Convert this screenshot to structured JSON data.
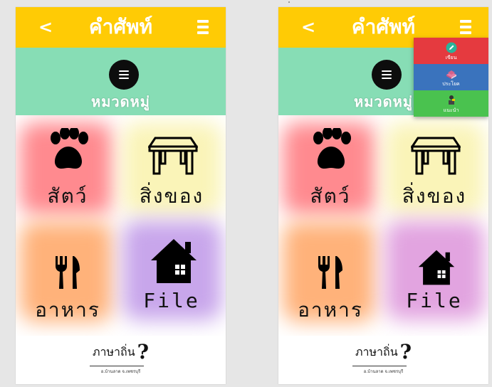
{
  "screens": [
    {
      "header": {
        "back_icon": "chevron-left-icon",
        "back_label": "<",
        "title": "คำศัพท์",
        "menu_icon": "hamburger-menu-icon"
      },
      "category": {
        "icon": "menu-circle-icon",
        "label": "หมวดหมู่"
      },
      "tiles": [
        {
          "icon": "paw-icon",
          "label": "สัตว์",
          "color": "#ff8a8f"
        },
        {
          "icon": "table-icon",
          "label": "สิ่งของ",
          "color": "#faf4b8"
        },
        {
          "icon": "fork-knife-icon",
          "label": "อาหาร",
          "color": "#ffb27a"
        },
        {
          "icon": "house-icon",
          "label": "File",
          "color": "#c8a6eb"
        }
      ],
      "footer": {
        "logo_text": "ภาษาถิ่น",
        "logo_prefix": "ภ",
        "question_mark": "?",
        "subtitle": "อ.บ้านลาด จ.เพชรบุรี"
      }
    },
    {
      "header": {
        "back_icon": "chevron-left-icon",
        "back_label": "<",
        "title": "คำศัพท์",
        "menu_icon": "hamburger-menu-icon"
      },
      "category": {
        "icon": "menu-circle-icon",
        "label": "หมวดหมู่"
      },
      "tiles": [
        {
          "icon": "paw-icon",
          "label": "สัตว์",
          "color": "#ff8a8f"
        },
        {
          "icon": "table-icon",
          "label": "สิ่งของ",
          "color": "#faf4b8"
        },
        {
          "icon": "fork-knife-icon",
          "label": "อาหาร",
          "color": "#ffb27a"
        },
        {
          "icon": "house-icon",
          "label": "File",
          "color": "#e2a4e0"
        }
      ],
      "dropdown": [
        {
          "icon": "pencil-icon",
          "label": "เขียน",
          "color": "#e53a3f"
        },
        {
          "icon": "book-icon",
          "label": "ประโยค",
          "color": "#3a73bd"
        },
        {
          "icon": "guide-icon",
          "label": "แนะนำ",
          "color": "#4ac24f"
        }
      ],
      "footer": {
        "logo_text": "ภาษาถิ่น",
        "logo_prefix": "ภ",
        "question_mark": "?",
        "subtitle": "อ.บ้านลาด จ.เพชรบุรี"
      }
    }
  ],
  "colors": {
    "header": "#ffcb05",
    "category_bar": "#87ddb5",
    "background": "#e6e6e6"
  }
}
